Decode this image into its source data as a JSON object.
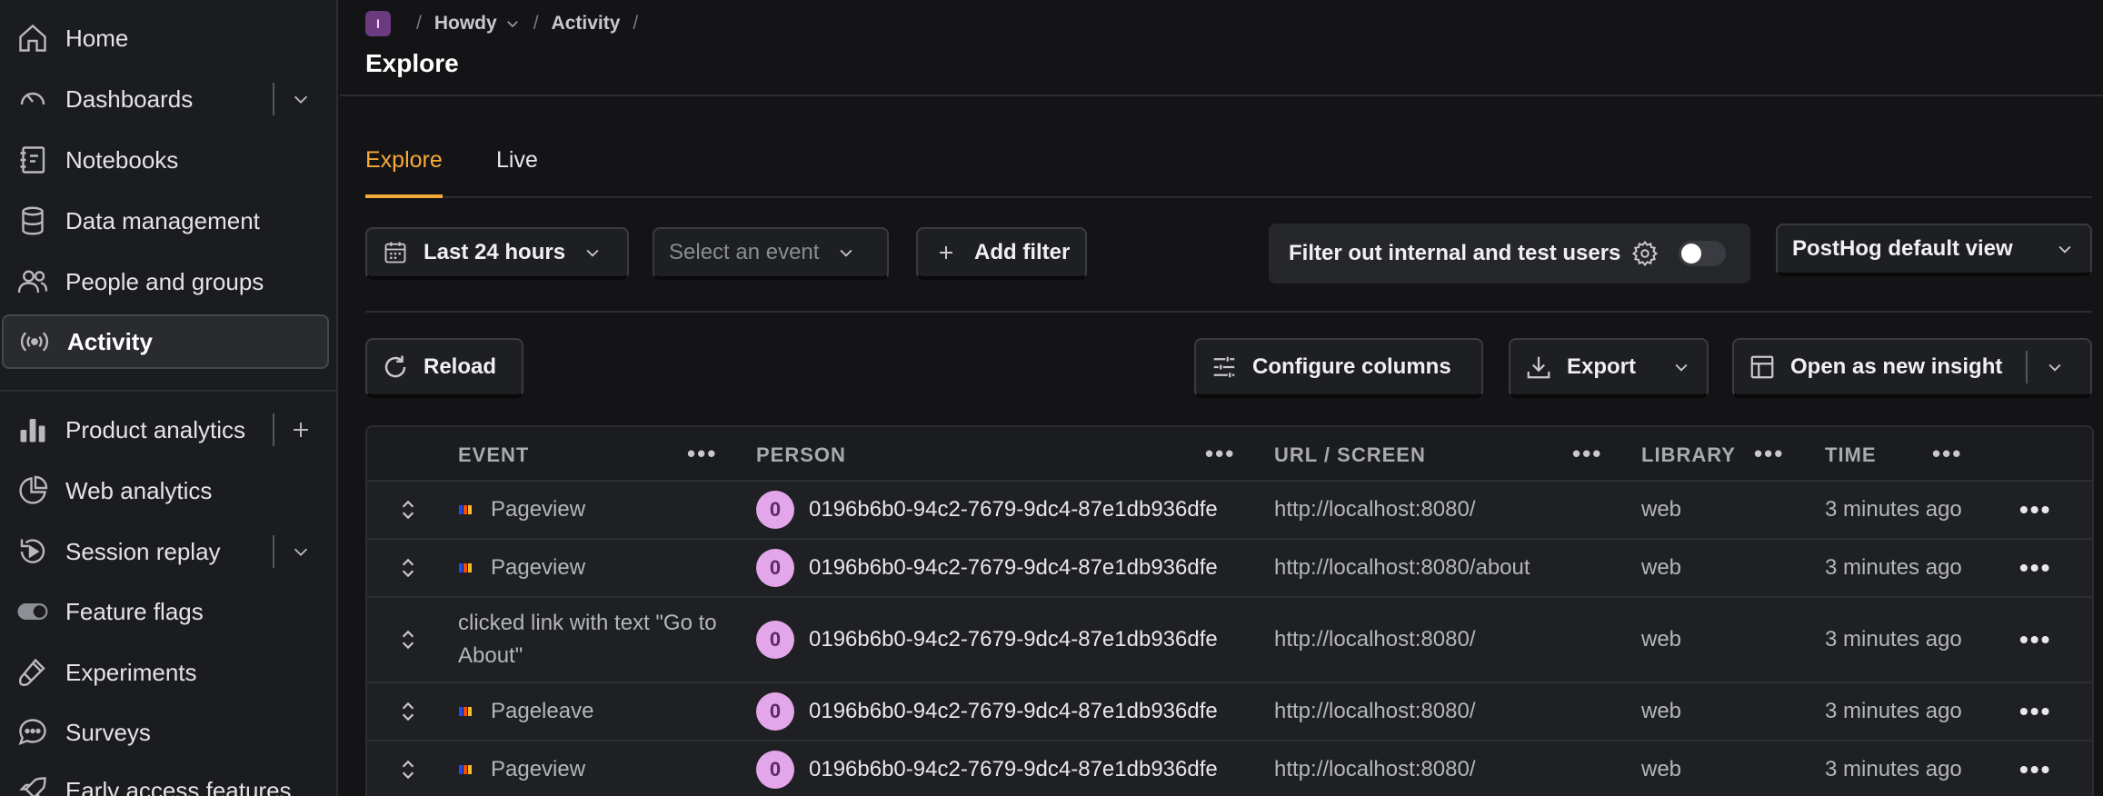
{
  "sidebar": {
    "items": [
      {
        "label": "Home",
        "icon": "home-icon"
      },
      {
        "label": "Dashboards",
        "icon": "dashboard-icon"
      },
      {
        "label": "Notebooks",
        "icon": "notebook-icon"
      },
      {
        "label": "Data management",
        "icon": "database-icon"
      },
      {
        "label": "People and groups",
        "icon": "people-icon"
      },
      {
        "label": "Activity",
        "icon": "activity-icon"
      },
      {
        "label": "Product analytics",
        "icon": "bar-chart-icon"
      },
      {
        "label": "Web analytics",
        "icon": "pie-chart-icon"
      },
      {
        "label": "Session replay",
        "icon": "replay-icon"
      },
      {
        "label": "Feature flags",
        "icon": "toggle-icon"
      },
      {
        "label": "Experiments",
        "icon": "flask-icon"
      },
      {
        "label": "Surveys",
        "icon": "chat-icon"
      },
      {
        "label": "Early access features",
        "icon": "rocket-icon"
      }
    ]
  },
  "breadcrumb": {
    "project_initial": "I",
    "project": "Howdy",
    "section": "Activity",
    "sep": "/"
  },
  "page_title": "Explore",
  "tabs": [
    {
      "label": "Explore",
      "active": true
    },
    {
      "label": "Live",
      "active": false
    }
  ],
  "filters": {
    "date_range": "Last 24 hours",
    "event_placeholder": "Select an event",
    "add_filter": "Add filter",
    "internal_users_label": "Filter out internal and test users",
    "internal_users_enabled": false,
    "view": "PostHog default view"
  },
  "toolbar": {
    "reload": "Reload",
    "configure_columns": "Configure columns",
    "export": "Export",
    "open_insight": "Open as new insight"
  },
  "table": {
    "columns": [
      "EVENT",
      "PERSON",
      "URL / SCREEN",
      "LIBRARY",
      "TIME"
    ],
    "rows": [
      {
        "event": "Pageview",
        "person_initial": "0",
        "person": "0196b6b0-94c2-7679-9dc4-87e1db936dfe",
        "url": "http://localhost:8080/",
        "library": "web",
        "time": "3 minutes ago"
      },
      {
        "event": "Pageview",
        "person_initial": "0",
        "person": "0196b6b0-94c2-7679-9dc4-87e1db936dfe",
        "url": "http://localhost:8080/about",
        "library": "web",
        "time": "3 minutes ago"
      },
      {
        "event_line1": "clicked link with text \"Go to",
        "event_line2": "About\"",
        "person_initial": "0",
        "person": "0196b6b0-94c2-7679-9dc4-87e1db936dfe",
        "url": "http://localhost:8080/",
        "library": "web",
        "time": "3 minutes ago"
      },
      {
        "event": "Pageleave",
        "person_initial": "0",
        "person": "0196b6b0-94c2-7679-9dc4-87e1db936dfe",
        "url": "http://localhost:8080/",
        "library": "web",
        "time": "3 minutes ago"
      },
      {
        "event": "Pageview",
        "person_initial": "0",
        "person": "0196b6b0-94c2-7679-9dc4-87e1db936dfe",
        "url": "http://localhost:8080/",
        "library": "web",
        "time": "3 minutes ago"
      }
    ]
  },
  "colors": {
    "accent": "#f7a93b",
    "avatar": "#e4a6ea",
    "background": "#141416"
  }
}
